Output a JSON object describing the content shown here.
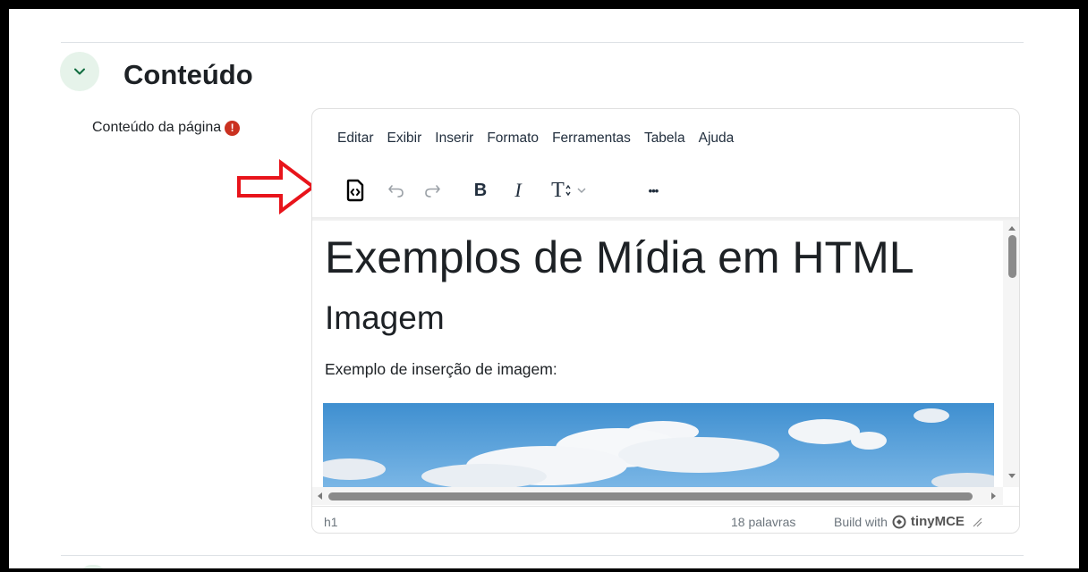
{
  "section": {
    "title": "Conteúdo",
    "collapse_icon": "chevron-down-icon",
    "accent_bg": "#e6f3ea",
    "accent": "#0f6c3f"
  },
  "field": {
    "label": "Conteúdo da página",
    "required_icon": "!"
  },
  "editor": {
    "menubar": [
      "Editar",
      "Exibir",
      "Inserir",
      "Formato",
      "Ferramentas",
      "Tabela",
      "Ajuda"
    ],
    "toolbar": {
      "source_code_icon": "source-code-icon",
      "undo_icon": "undo-icon",
      "redo_icon": "redo-icon",
      "bold_label": "B",
      "italic_label": "I",
      "text_size_label": "T",
      "more_label": "•••"
    },
    "content": {
      "heading1": "Exemplos de Mídia em HTML",
      "heading2": "Imagem",
      "paragraph": "Exemplo de inserção de imagem:"
    },
    "status": {
      "path": "h1",
      "word_count": "18 palavras",
      "build_with": "Build with",
      "brand": "tinyMCE"
    }
  },
  "annotation": {
    "color": "#e8141b"
  }
}
